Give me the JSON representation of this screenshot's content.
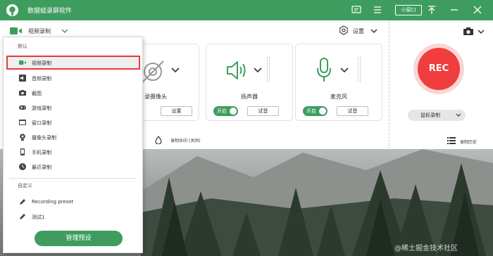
{
  "app": {
    "title": "数据蛙录屏软件",
    "mini_window_label": "小窗口"
  },
  "mode": {
    "label": "视频录制",
    "settings_label": "设置"
  },
  "cards": [
    {
      "name": "录摄像头",
      "settings_label": "设置"
    },
    {
      "name": "扬声器",
      "toggle_label": "开启",
      "test_label": "试音"
    },
    {
      "name": "麦克风",
      "toggle_label": "开启",
      "test_label": "试音"
    }
  ],
  "rec": {
    "label": "REC",
    "mouse_record_label": "鼠标录制"
  },
  "bottom": {
    "watermark_label": "录制水印 (关闭)",
    "history_label": "录制历史"
  },
  "dropdown": {
    "default_header": "默认",
    "items": [
      "视频录制",
      "音频录制",
      "截图",
      "游戏录制",
      "窗口录制",
      "摄像头录制",
      "手机录制",
      "最近录制"
    ],
    "custom_header": "自定义",
    "custom_items": [
      "Recording preset",
      "测试1"
    ],
    "manage_label": "管理预设"
  },
  "watermark": "@稀土掘金技术社区",
  "colors": {
    "brand_green": "#3e9d5e",
    "rec_red": "#f03d3d",
    "highlight_red": "#e53b3b"
  }
}
